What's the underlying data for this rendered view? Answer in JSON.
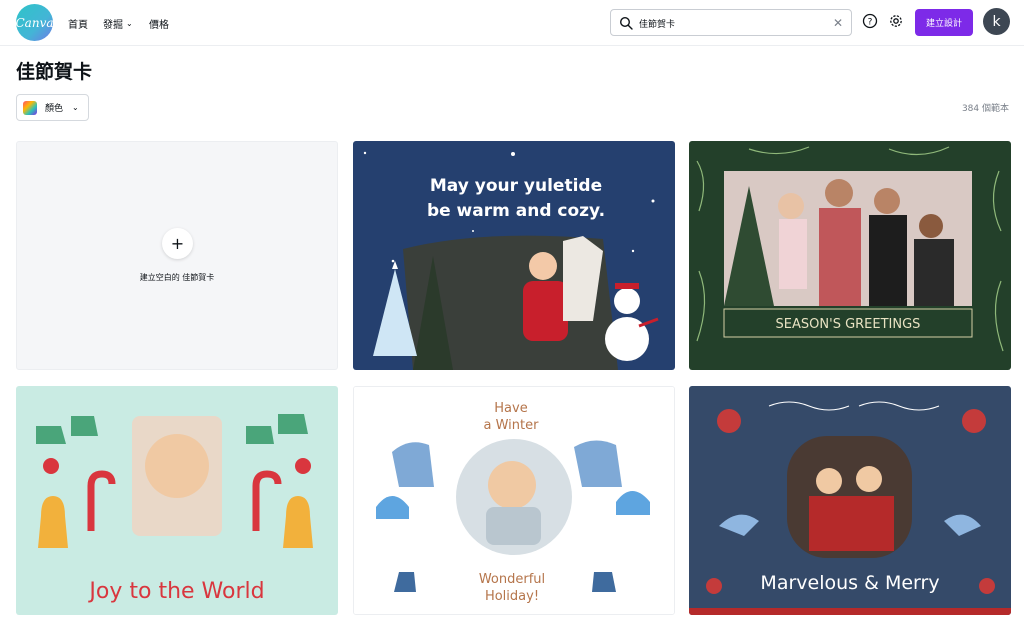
{
  "header": {
    "logo_text": "Canva",
    "nav": {
      "home": "首頁",
      "discover": "發掘",
      "pricing": "價格"
    },
    "search": {
      "value": "佳節賀卡",
      "placeholder": ""
    },
    "create_button": "建立設計",
    "avatar_initial": "k",
    "icons": [
      "canva-logo",
      "search-icon",
      "clear-icon",
      "help-icon",
      "settings-icon",
      "chevron-down-icon"
    ]
  },
  "page": {
    "title": "佳節賀卡",
    "filter_label": "顏色",
    "template_count": "384 個範本"
  },
  "templates": [
    {
      "label": "建立空白的 佳節賀卡",
      "type": "blank"
    },
    {
      "text": "May your yuletide be warm and cozy.",
      "line1": "May your yuletide",
      "line2": "be warm and cozy.",
      "bg": "#25406f"
    },
    {
      "text": "SEASON'S GREETINGS",
      "bg": "#23402a"
    },
    {
      "text": "Joy to the World",
      "bg": "#c9ebe3",
      "accent": "#d9363e"
    },
    {
      "text": "Have a Winter Wonderful Holiday!",
      "top1": "Have",
      "top2": "a Winter",
      "bottom1": "Wonderful",
      "bottom2": "Holiday!",
      "bg": "#ffffff",
      "accent": "#b5754b"
    },
    {
      "text": "Marvelous & Merry",
      "bg": "#354a69"
    }
  ],
  "colors": {
    "brand_purple": "#7d2ae8",
    "avatar_bg": "#3d4753"
  }
}
